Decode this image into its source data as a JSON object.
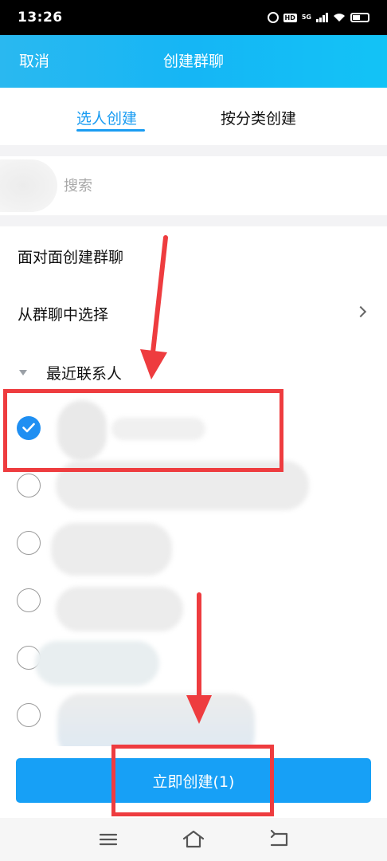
{
  "status_bar": {
    "time": "13:26",
    "hd": "HD",
    "network": "5G"
  },
  "header": {
    "cancel": "取消",
    "title": "创建群聊"
  },
  "tabs": [
    {
      "label": "选人创建",
      "active": true
    },
    {
      "label": "按分类创建",
      "active": false
    }
  ],
  "search": {
    "placeholder": "搜索"
  },
  "menu": [
    {
      "label": "面对面创建群聊",
      "chevron": false
    },
    {
      "label": "从群聊中选择",
      "chevron": true
    }
  ],
  "section": {
    "label": "最近联系人",
    "expanded": true
  },
  "contacts": [
    {
      "checked": true
    },
    {
      "checked": false
    },
    {
      "checked": false
    },
    {
      "checked": false
    },
    {
      "checked": false
    },
    {
      "checked": false
    }
  ],
  "create_button": {
    "label": "立即创建(1)",
    "selected_count": 1
  },
  "colors": {
    "accent": "#17a0f6",
    "header": "#15b6f5",
    "annotation": "#ee3c3f"
  }
}
